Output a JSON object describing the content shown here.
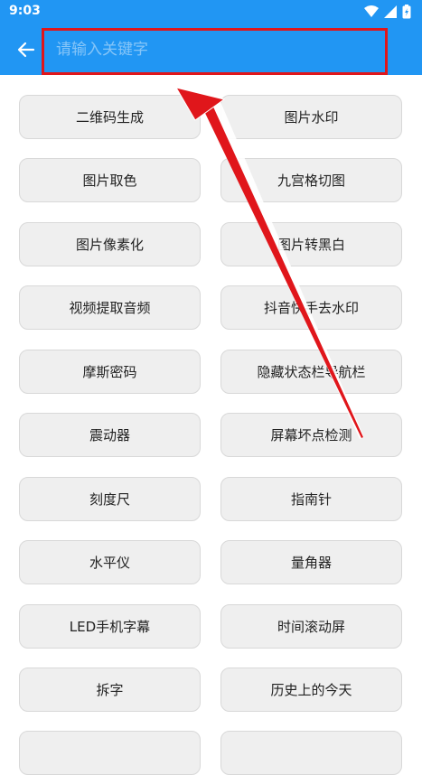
{
  "status_bar": {
    "time": "9:03"
  },
  "search": {
    "placeholder": "请输入关键字"
  },
  "tools": {
    "left": [
      "二维码生成",
      "图片取色",
      "图片像素化",
      "视频提取音频",
      "摩斯密码",
      "震动器",
      "刻度尺",
      "水平仪",
      "LED手机字幕",
      "拆字"
    ],
    "right": [
      "图片水印",
      "九宫格切图",
      "图片转黑白",
      "抖音快手去水印",
      "隐藏状态栏导航栏",
      "屏幕坏点检测",
      "指南针",
      "量角器",
      "时间滚动屏",
      "历史上的今天"
    ]
  },
  "colors": {
    "accent": "#2196f3",
    "annotation": "#e0161b"
  }
}
